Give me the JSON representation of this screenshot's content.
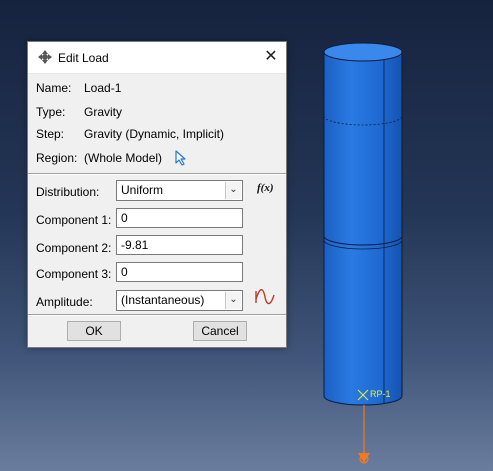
{
  "dialog": {
    "title": "Edit Load",
    "close_glyph": "✕",
    "icon": "load-editor-icon",
    "info": {
      "name_label": "Name:",
      "name_value": "Load-1",
      "type_label": "Type:",
      "type_value": "Gravity",
      "step_label": "Step:",
      "step_value": "Gravity (Dynamic, Implicit)",
      "region_label": "Region:",
      "region_value": "(Whole Model)",
      "region_icon": "select-region-cursor-icon"
    },
    "form": {
      "distribution_label": "Distribution:",
      "distribution_value": "Uniform",
      "fx_label": "f(x)",
      "component1_label": "Component 1:",
      "component1_value": "0",
      "component2_label": "Component 2:",
      "component2_value": "-9.81",
      "component3_label": "Component 3:",
      "component3_value": "0",
      "amplitude_label": "Amplitude:",
      "amplitude_value": "(Instantaneous)",
      "amplitude_icon": "create-amplitude-icon"
    },
    "buttons": {
      "ok": "OK",
      "cancel": "Cancel"
    }
  },
  "viewport": {
    "reference_point_label": "RP-1",
    "model_color": "#1f6fd6",
    "axis_color": "#f07a20"
  }
}
